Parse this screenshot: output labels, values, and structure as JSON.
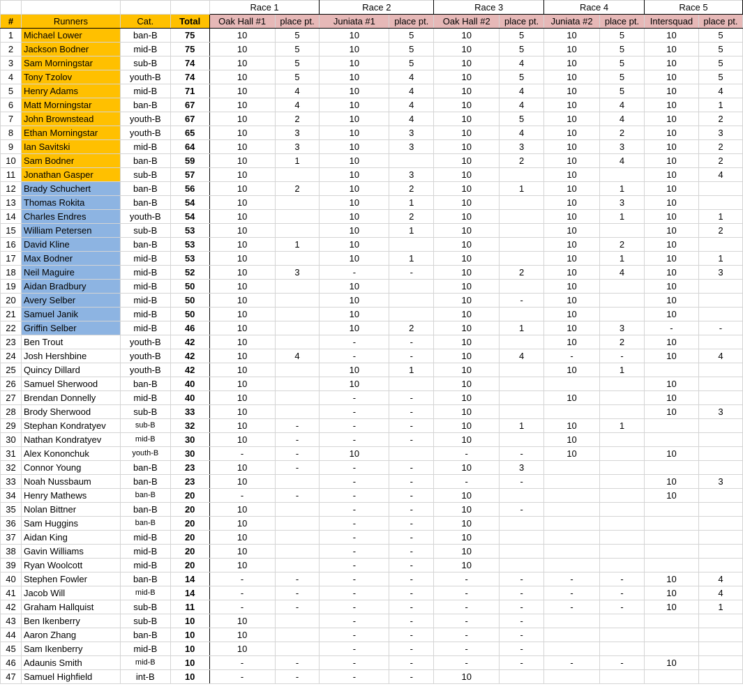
{
  "colors": {
    "top_group": "#ffc000",
    "second_group": "#8db4e2",
    "race_header": "#e6b8b7"
  },
  "races": [
    {
      "label": "Race 1",
      "meet": "Oak Hall #1"
    },
    {
      "label": "Race 2",
      "meet": "Juniata #1"
    },
    {
      "label": "Race 3",
      "meet": "Oak Hall #2"
    },
    {
      "label": "Race 4",
      "meet": "Juniata #2"
    },
    {
      "label": "Race 5",
      "meet": "Intersquad"
    }
  ],
  "headers": {
    "num": "#",
    "runner": "Runners",
    "cat": "Cat.",
    "total": "Total",
    "place": "place pt."
  },
  "rows": [
    {
      "n": "1",
      "name": "Michael Lower",
      "cat": "ban-B",
      "total": "75",
      "c": [
        "10",
        "5",
        "10",
        "5",
        "10",
        "5",
        "10",
        "5",
        "10",
        "5"
      ]
    },
    {
      "n": "2",
      "name": "Jackson Bodner",
      "cat": "mid-B",
      "total": "75",
      "c": [
        "10",
        "5",
        "10",
        "5",
        "10",
        "5",
        "10",
        "5",
        "10",
        "5"
      ]
    },
    {
      "n": "3",
      "name": "Sam Morningstar",
      "cat": "sub-B",
      "total": "74",
      "c": [
        "10",
        "5",
        "10",
        "5",
        "10",
        "4",
        "10",
        "5",
        "10",
        "5"
      ]
    },
    {
      "n": "4",
      "name": "Tony Tzolov",
      "cat": "youth-B",
      "total": "74",
      "c": [
        "10",
        "5",
        "10",
        "4",
        "10",
        "5",
        "10",
        "5",
        "10",
        "5"
      ]
    },
    {
      "n": "5",
      "name": "Henry Adams",
      "cat": "mid-B",
      "total": "71",
      "c": [
        "10",
        "4",
        "10",
        "4",
        "10",
        "4",
        "10",
        "5",
        "10",
        "4"
      ]
    },
    {
      "n": "6",
      "name": "Matt Morningstar",
      "cat": "ban-B",
      "total": "67",
      "c": [
        "10",
        "4",
        "10",
        "4",
        "10",
        "4",
        "10",
        "4",
        "10",
        "1"
      ]
    },
    {
      "n": "7",
      "name": "John Brownstead",
      "cat": "youth-B",
      "total": "67",
      "c": [
        "10",
        "2",
        "10",
        "4",
        "10",
        "5",
        "10",
        "4",
        "10",
        "2"
      ]
    },
    {
      "n": "8",
      "name": "Ethan Morningstar",
      "cat": "youth-B",
      "total": "65",
      "c": [
        "10",
        "3",
        "10",
        "3",
        "10",
        "4",
        "10",
        "2",
        "10",
        "3"
      ]
    },
    {
      "n": "9",
      "name": "Ian Savitski",
      "cat": "mid-B",
      "total": "64",
      "c": [
        "10",
        "3",
        "10",
        "3",
        "10",
        "3",
        "10",
        "3",
        "10",
        "2"
      ]
    },
    {
      "n": "10",
      "name": "Sam Bodner",
      "cat": "ban-B",
      "total": "59",
      "c": [
        "10",
        "1",
        "10",
        "",
        "10",
        "2",
        "10",
        "4",
        "10",
        "2"
      ]
    },
    {
      "n": "11",
      "name": "Jonathan Gasper",
      "cat": "sub-B",
      "total": "57",
      "c": [
        "10",
        "",
        "10",
        "3",
        "10",
        "",
        "10",
        "",
        "10",
        "4"
      ]
    },
    {
      "n": "12",
      "name": "Brady Schuchert",
      "cat": "ban-B",
      "total": "56",
      "c": [
        "10",
        "2",
        "10",
        "2",
        "10",
        "1",
        "10",
        "1",
        "10",
        ""
      ]
    },
    {
      "n": "13",
      "name": "Thomas Rokita",
      "cat": "ban-B",
      "total": "54",
      "c": [
        "10",
        "",
        "10",
        "1",
        "10",
        "",
        "10",
        "3",
        "10",
        ""
      ]
    },
    {
      "n": "14",
      "name": "Charles Endres",
      "cat": "youth-B",
      "total": "54",
      "c": [
        "10",
        "",
        "10",
        "2",
        "10",
        "",
        "10",
        "1",
        "10",
        "1"
      ]
    },
    {
      "n": "15",
      "name": "William Petersen",
      "cat": "sub-B",
      "total": "53",
      "c": [
        "10",
        "",
        "10",
        "1",
        "10",
        "",
        "10",
        "",
        "10",
        "2"
      ]
    },
    {
      "n": "16",
      "name": "David Kline",
      "cat": "ban-B",
      "total": "53",
      "c": [
        "10",
        "1",
        "10",
        "",
        "10",
        "",
        "10",
        "2",
        "10",
        ""
      ]
    },
    {
      "n": "17",
      "name": "Max Bodner",
      "cat": "mid-B",
      "total": "53",
      "c": [
        "10",
        "",
        "10",
        "1",
        "10",
        "",
        "10",
        "1",
        "10",
        "1"
      ]
    },
    {
      "n": "18",
      "name": "Neil Maguire",
      "cat": "mid-B",
      "total": "52",
      "c": [
        "10",
        "3",
        "-",
        "-",
        "10",
        "2",
        "10",
        "4",
        "10",
        "3"
      ]
    },
    {
      "n": "19",
      "name": "Aidan Bradbury",
      "cat": "mid-B",
      "total": "50",
      "c": [
        "10",
        "",
        "10",
        "",
        "10",
        "",
        "10",
        "",
        "10",
        ""
      ]
    },
    {
      "n": "20",
      "name": "Avery Selber",
      "cat": "mid-B",
      "total": "50",
      "c": [
        "10",
        "",
        "10",
        "",
        "10",
        "-",
        "10",
        "",
        "10",
        ""
      ]
    },
    {
      "n": "21",
      "name": "Samuel Janik",
      "cat": "mid-B",
      "total": "50",
      "c": [
        "10",
        "",
        "10",
        "",
        "10",
        "",
        "10",
        "",
        "10",
        ""
      ]
    },
    {
      "n": "22",
      "name": "Griffin Selber",
      "cat": "mid-B",
      "total": "46",
      "c": [
        "10",
        "",
        "10",
        "2",
        "10",
        "1",
        "10",
        "3",
        "-",
        "-"
      ]
    },
    {
      "n": "23",
      "name": "Ben Trout",
      "cat": "youth-B",
      "total": "42",
      "c": [
        "10",
        "",
        "-",
        "-",
        "10",
        "",
        "10",
        "2",
        "10",
        ""
      ]
    },
    {
      "n": "24",
      "name": "Josh Hershbine",
      "cat": "youth-B",
      "total": "42",
      "c": [
        "10",
        "4",
        "-",
        "-",
        "10",
        "4",
        "-",
        "-",
        "10",
        "4"
      ]
    },
    {
      "n": "25",
      "name": "Quincy Dillard",
      "cat": "youth-B",
      "total": "42",
      "c": [
        "10",
        "",
        "10",
        "1",
        "10",
        "",
        "10",
        "1",
        "",
        ""
      ]
    },
    {
      "n": "26",
      "name": "Samuel Sherwood",
      "cat": "ban-B",
      "total": "40",
      "c": [
        "10",
        "",
        "10",
        "",
        "10",
        "",
        "",
        "",
        "10",
        ""
      ]
    },
    {
      "n": "27",
      "name": "Brendan Donnelly",
      "cat": "mid-B",
      "total": "40",
      "c": [
        "10",
        "",
        "-",
        "-",
        "10",
        "",
        "10",
        "",
        "10",
        ""
      ]
    },
    {
      "n": "28",
      "name": "Brody Sherwood",
      "cat": "sub-B",
      "total": "33",
      "c": [
        "10",
        "",
        "-",
        "-",
        "10",
        "",
        "",
        "",
        "10",
        "3"
      ]
    },
    {
      "n": "29",
      "name": "Stephan Kondratyev",
      "cat": "sub-B",
      "total": "32",
      "c": [
        "10",
        "-",
        "-",
        "-",
        "10",
        "1",
        "10",
        "1",
        "",
        ""
      ]
    },
    {
      "n": "30",
      "name": "Nathan Kondratyev",
      "cat": "mid-B",
      "total": "30",
      "c": [
        "10",
        "-",
        "-",
        "-",
        "10",
        "",
        "10",
        "",
        "",
        ""
      ]
    },
    {
      "n": "31",
      "name": "Alex Kononchuk",
      "cat": "youth-B",
      "total": "30",
      "c": [
        "-",
        "-",
        "10",
        "",
        "-",
        "-",
        "10",
        "",
        "10",
        ""
      ]
    },
    {
      "n": "32",
      "name": "Connor Young",
      "cat": "ban-B",
      "total": "23",
      "c": [
        "10",
        "-",
        "-",
        "-",
        "10",
        "3",
        "",
        "",
        "",
        ""
      ]
    },
    {
      "n": "33",
      "name": "Noah Nussbaum",
      "cat": "ban-B",
      "total": "23",
      "c": [
        "10",
        "",
        "-",
        "-",
        "-",
        "-",
        "",
        "",
        "10",
        "3"
      ]
    },
    {
      "n": "34",
      "name": "Henry Mathews",
      "cat": "ban-B",
      "total": "20",
      "c": [
        "-",
        "-",
        "-",
        "-",
        "10",
        "",
        "",
        "",
        "10",
        ""
      ]
    },
    {
      "n": "35",
      "name": "Nolan Bittner",
      "cat": "ban-B",
      "total": "20",
      "c": [
        "10",
        "",
        "-",
        "-",
        "10",
        "-",
        "",
        "",
        "",
        ""
      ]
    },
    {
      "n": "36",
      "name": "Sam Huggins",
      "cat": "ban-B",
      "total": "20",
      "c": [
        "10",
        "",
        "-",
        "-",
        "10",
        "",
        "",
        "",
        "",
        ""
      ]
    },
    {
      "n": "37",
      "name": "Aidan King",
      "cat": "mid-B",
      "total": "20",
      "c": [
        "10",
        "",
        "-",
        "-",
        "10",
        "",
        "",
        "",
        "",
        ""
      ]
    },
    {
      "n": "38",
      "name": "Gavin Williams",
      "cat": "mid-B",
      "total": "20",
      "c": [
        "10",
        "",
        "-",
        "-",
        "10",
        "",
        "",
        "",
        "",
        ""
      ]
    },
    {
      "n": "39",
      "name": "Ryan Woolcott",
      "cat": "mid-B",
      "total": "20",
      "c": [
        "10",
        "",
        "-",
        "-",
        "10",
        "",
        "",
        "",
        "",
        ""
      ]
    },
    {
      "n": "40",
      "name": "Stephen Fowler",
      "cat": "ban-B",
      "total": "14",
      "c": [
        "-",
        "-",
        "-",
        "-",
        "-",
        "-",
        "-",
        "-",
        "10",
        "4"
      ]
    },
    {
      "n": "41",
      "name": "Jacob Will",
      "cat": "mid-B",
      "total": "14",
      "c": [
        "-",
        "-",
        "-",
        "-",
        "-",
        "-",
        "-",
        "-",
        "10",
        "4"
      ]
    },
    {
      "n": "42",
      "name": "Graham Hallquist",
      "cat": "sub-B",
      "total": "11",
      "c": [
        "-",
        "-",
        "-",
        "-",
        "-",
        "-",
        "-",
        "-",
        "10",
        "1"
      ]
    },
    {
      "n": "43",
      "name": "Ben Ikenberry",
      "cat": "sub-B",
      "total": "10",
      "c": [
        "10",
        "",
        "-",
        "-",
        "-",
        "-",
        "",
        "",
        "",
        ""
      ]
    },
    {
      "n": "44",
      "name": "Aaron Zhang",
      "cat": "ban-B",
      "total": "10",
      "c": [
        "10",
        "",
        "-",
        "-",
        "-",
        "-",
        "",
        "",
        "",
        ""
      ]
    },
    {
      "n": "45",
      "name": "Sam Ikenberry",
      "cat": "mid-B",
      "total": "10",
      "c": [
        "10",
        "",
        "-",
        "-",
        "-",
        "-",
        "",
        "",
        "",
        ""
      ]
    },
    {
      "n": "46",
      "name": "Adaunis Smith",
      "cat": "mid-B",
      "total": "10",
      "c": [
        "-",
        "-",
        "-",
        "-",
        "-",
        "-",
        "-",
        "-",
        "10",
        ""
      ]
    },
    {
      "n": "47",
      "name": "Samuel Highfield",
      "cat": "int-B",
      "total": "10",
      "c": [
        "-",
        "-",
        "-",
        "-",
        "10",
        "",
        "",
        "",
        "",
        ""
      ]
    }
  ]
}
